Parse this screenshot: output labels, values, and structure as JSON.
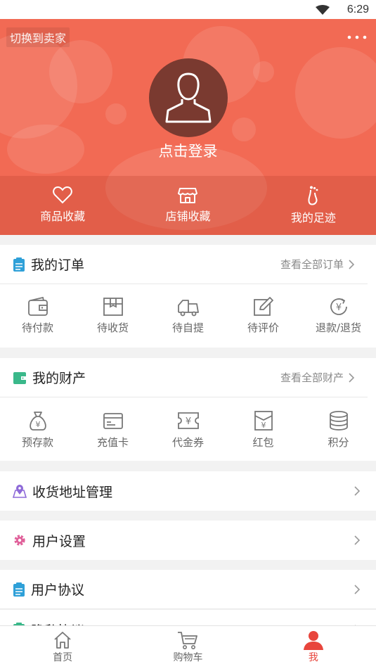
{
  "status_bar": {
    "time": "6:29"
  },
  "header": {
    "switch_label": "切换到卖家",
    "login_label": "点击登录",
    "quick_links": [
      {
        "label": "商品收藏",
        "icon": "heart-icon"
      },
      {
        "label": "店铺收藏",
        "icon": "store-icon"
      },
      {
        "label": "我的足迹",
        "icon": "footprint-icon"
      }
    ]
  },
  "orders": {
    "title": "我的订单",
    "more_label": "查看全部订单",
    "items": [
      {
        "label": "待付款",
        "icon": "wallet-icon"
      },
      {
        "label": "待收货",
        "icon": "package-icon"
      },
      {
        "label": "待自提",
        "icon": "truck-icon"
      },
      {
        "label": "待评价",
        "icon": "edit-icon"
      },
      {
        "label": "退款/退货",
        "icon": "refund-icon"
      }
    ]
  },
  "assets": {
    "title": "我的财产",
    "more_label": "查看全部财产",
    "items": [
      {
        "label": "预存款",
        "icon": "money-bag-icon"
      },
      {
        "label": "充值卡",
        "icon": "card-icon"
      },
      {
        "label": "代金券",
        "icon": "voucher-icon"
      },
      {
        "label": "红包",
        "icon": "red-envelope-icon"
      },
      {
        "label": "积分",
        "icon": "coins-icon"
      }
    ]
  },
  "menu": [
    {
      "label": "收货地址管理",
      "icon": "map-pin-icon"
    },
    {
      "label": "用户设置",
      "icon": "gear-icon"
    },
    {
      "label": "用户协议",
      "icon": "notepad-icon"
    },
    {
      "label": "隐私协议",
      "icon": "notepad-icon"
    }
  ],
  "tabbar": [
    {
      "label": "首页",
      "icon": "home-icon"
    },
    {
      "label": "购物车",
      "icon": "cart-icon"
    },
    {
      "label": "我",
      "icon": "user-icon"
    }
  ],
  "colors": {
    "brand": "#f26a54",
    "accent": "#e8453c",
    "notepad": "#2fa0d8",
    "wallet_green": "#3ab88a",
    "map_purple": "#8e6ad8",
    "gear_pink": "#e0609a"
  }
}
